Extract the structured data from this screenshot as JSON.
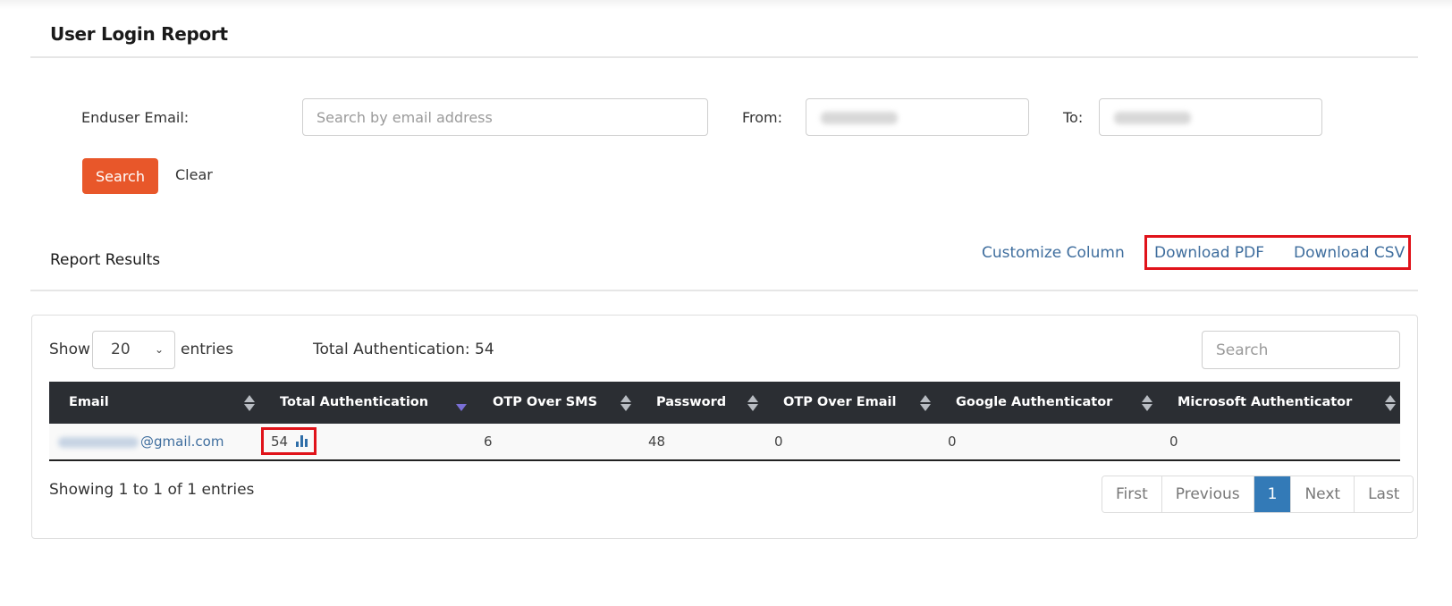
{
  "page": {
    "title": "User Login Report"
  },
  "filters": {
    "email_label": "Enduser Email:",
    "email_placeholder": "Search by email address",
    "email_value": "",
    "from_label": "From:",
    "from_value": "[redacted date]",
    "to_label": "To:",
    "to_value": "[redacted date]",
    "search_label": "Search",
    "clear_label": "Clear"
  },
  "results": {
    "title": "Report Results",
    "customize_column": "Customize Column",
    "download_pdf": "Download PDF",
    "download_csv": "Download CSV"
  },
  "table_controls": {
    "show_label": "Show",
    "entries_value": "20",
    "entries_label": "entries",
    "total_auth_text": "Total Authentication: 54",
    "search_placeholder": "Search"
  },
  "table": {
    "columns": [
      {
        "label": "Email"
      },
      {
        "label": "Total Authentication"
      },
      {
        "label": "OTP Over SMS"
      },
      {
        "label": "Password"
      },
      {
        "label": "OTP Over Email"
      },
      {
        "label": "Google Authenticator"
      },
      {
        "label": "Microsoft Authenticator"
      }
    ],
    "rows": [
      {
        "email_domain": "@gmail.com",
        "total": "54",
        "otp_sms": "6",
        "password": "48",
        "otp_email": "0",
        "google_auth": "0",
        "microsoft_auth": "0"
      }
    ]
  },
  "footer": {
    "info": "Showing 1 to 1 of 1 entries",
    "pager": {
      "first": "First",
      "previous": "Previous",
      "current": "1",
      "next": "Next",
      "last": "Last"
    }
  },
  "colors": {
    "accent": "#e8572a",
    "link": "#3f6e9e",
    "header_bg": "#2b2e33",
    "pager_active": "#337ab7",
    "highlight": "#e0131a"
  }
}
